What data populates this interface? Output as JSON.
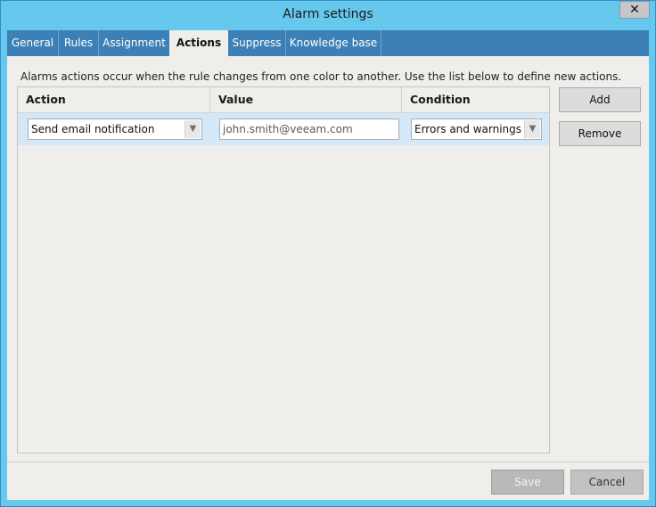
{
  "window": {
    "title": "Alarm settings",
    "close_glyph": "✕"
  },
  "tabs": [
    {
      "label": "General"
    },
    {
      "label": "Rules"
    },
    {
      "label": "Assignment"
    },
    {
      "label": "Actions",
      "active": true
    },
    {
      "label": "Suppress"
    },
    {
      "label": "Knowledge base"
    }
  ],
  "actions": {
    "description": "Alarms actions occur when the rule changes from one color to another. Use the list below to define new actions.",
    "columns": {
      "action": "Action",
      "value": "Value",
      "condition": "Condition"
    },
    "rows": [
      {
        "action": "Send email notification",
        "value": "john.smith@veeam.com",
        "condition": "Errors and warnings"
      }
    ],
    "add_label": "Add",
    "remove_label": "Remove"
  },
  "footer": {
    "save_label": "Save",
    "cancel_label": "Cancel"
  },
  "icons": {
    "dropdown_arrow": "chevron-down-icon",
    "close": "close-icon"
  },
  "colors": {
    "title_bar": "#66c8ec",
    "tab_bar": "#3c80b6",
    "selected_row": "#d5e8f8",
    "panel": "#f0eeea"
  }
}
